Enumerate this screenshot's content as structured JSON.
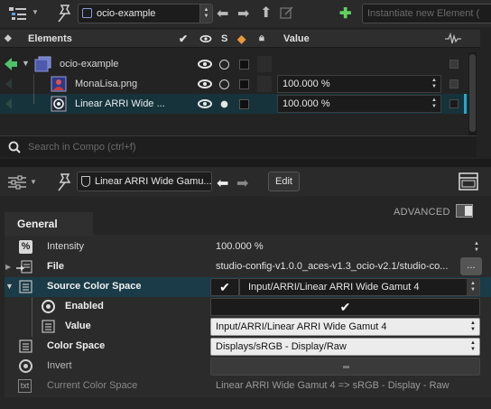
{
  "toolbar": {
    "composition": "ocio-example",
    "instantiate_placeholder": "Instantiate new Element (",
    "add_symbol": "✚"
  },
  "outliner": {
    "header": {
      "elements_label": "Elements",
      "s_label": "S",
      "value_label": "Value"
    },
    "rows": [
      {
        "name": "ocio-example",
        "value": ""
      },
      {
        "name": "MonaLisa.png",
        "value": "100.000 %"
      },
      {
        "name": "Linear ARRI Wide ...",
        "value": "100.000 %"
      }
    ],
    "search_placeholder": "Search in Compo (ctrl+f)"
  },
  "properties": {
    "node_name": "Linear ARRI Wide Gamu...",
    "edit_label": "Edit",
    "tab_label": "General",
    "advanced_label": "ADVANCED",
    "items": [
      {
        "label": "Intensity",
        "value": "100.000 %"
      },
      {
        "label": "File",
        "value": "studio-config-v1.0.0_aces-v1.3_ocio-v2.1/studio-co...",
        "button": "..."
      },
      {
        "label": "Source Color Space",
        "value": "Input/ARRI/Linear ARRI Wide Gamut 4"
      },
      {
        "label": "Enabled",
        "value": "✔"
      },
      {
        "label": "Value",
        "value": "Input/ARRI/Linear ARRI Wide Gamut 4"
      },
      {
        "label": "Color Space",
        "value": "Displays/sRGB - Display/Raw"
      },
      {
        "label": "Invert",
        "value": ""
      },
      {
        "label": "Current Color Space",
        "value": "Linear ARRI Wide Gamut 4 => sRGB - Display - Raw"
      }
    ],
    "icon_text_txt": "txt",
    "icon_text_percent": "%"
  },
  "colors": {
    "selection": "#16333b",
    "accent_green": "#5fd35f",
    "background": "#252525"
  }
}
